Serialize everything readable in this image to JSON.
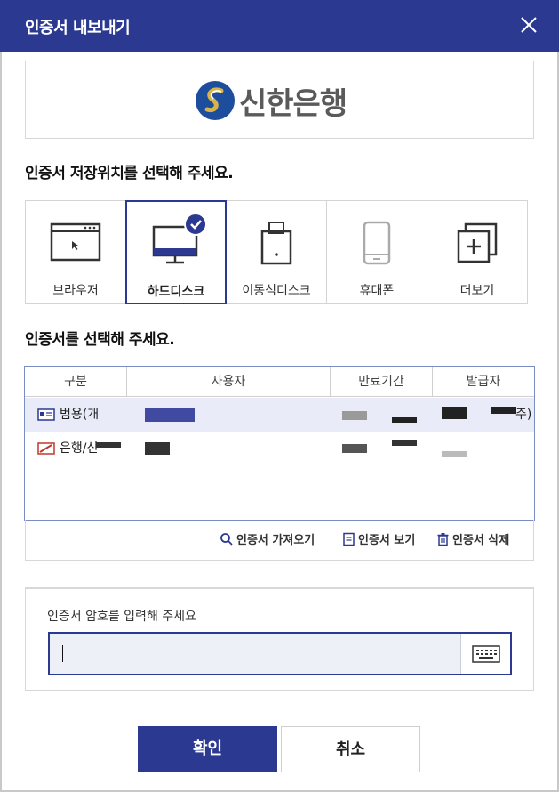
{
  "dialog": {
    "title": "인증서 내보내기",
    "close_icon": "close-icon"
  },
  "bank": {
    "name": "신한은행",
    "logo_icon": "shinhan-logo-icon"
  },
  "location": {
    "heading": "인증서 저장위치를 선택해 주세요.",
    "items": [
      {
        "label": "브라우저",
        "icon": "browser-window-icon",
        "selected": false
      },
      {
        "label": "하드디스크",
        "icon": "monitor-icon",
        "selected": true
      },
      {
        "label": "이동식디스크",
        "icon": "usb-drive-icon",
        "selected": false
      },
      {
        "label": "휴대폰",
        "icon": "phone-icon",
        "selected": false
      },
      {
        "label": "더보기",
        "icon": "more-plus-icon",
        "selected": false
      }
    ]
  },
  "certs": {
    "heading": "인증서를 선택해 주세요.",
    "columns": [
      "구분",
      "사용자",
      "만료기간",
      "발급자"
    ],
    "rows": [
      {
        "type": "범용(개",
        "issuer_tail": "주)",
        "selected": true,
        "icon": "cert-card-icon"
      },
      {
        "type": "은행/신",
        "issuer_tail": "",
        "selected": false,
        "icon": "cert-bank-icon"
      }
    ],
    "actions": {
      "import": "인증서 가져오기",
      "view": "인증서 보기",
      "delete": "인증서 삭제"
    }
  },
  "password": {
    "label": "인증서 암호를 입력해 주세요",
    "value": "",
    "keyboard_icon": "keyboard-icon"
  },
  "buttons": {
    "confirm": "확인",
    "cancel": "취소"
  },
  "colors": {
    "accent": "#2b3990",
    "selected_row": "#e9ecf8"
  }
}
